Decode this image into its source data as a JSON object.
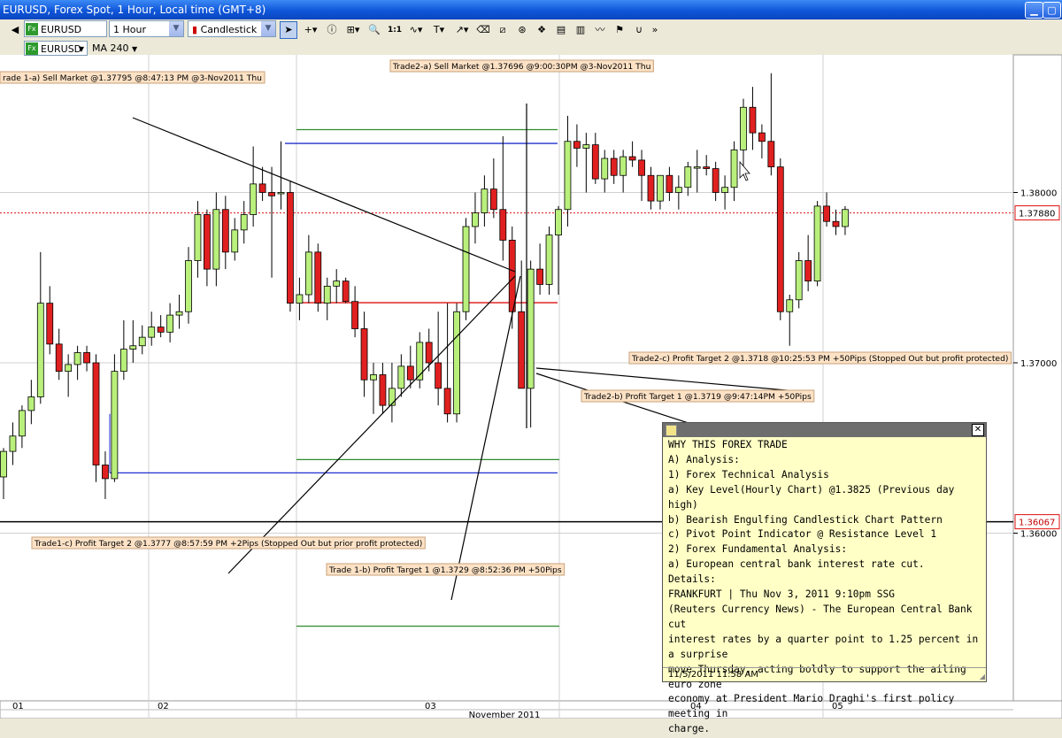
{
  "window": {
    "title": "EURUSD, Forex Spot, 1 Hour, Local time (GMT+8)"
  },
  "toolbar": {
    "symbol": "EURUSD",
    "timeframe": "1 Hour",
    "chart_type": "Candlestick",
    "ratio_label": "1:1",
    "fx_badge": "Fx"
  },
  "indicator_bar": {
    "symbol": "EURUSD",
    "indicator": "MA 240",
    "fx_badge": "Fx"
  },
  "colors": {
    "bull": "#b9f07c",
    "bear": "#e02020",
    "grid": "#d0d0d0",
    "bg": "#ffffff"
  },
  "chart_data": {
    "type": "candlestick",
    "price_axis": {
      "ticks": [
        "1.38000",
        "1.37000",
        "1.36000"
      ],
      "range": [
        1.3537,
        1.389
      ]
    },
    "time_axis": {
      "labels": [
        "01",
        "02",
        "03",
        "04",
        "05"
      ],
      "footer": "November 2011"
    },
    "current_price_label": "1.37880",
    "support_price_label": "1.36067",
    "candles": [
      {
        "o": 1.3633,
        "h": 1.365,
        "l": 1.362,
        "c": 1.3648
      },
      {
        "o": 1.3648,
        "h": 1.3665,
        "l": 1.364,
        "c": 1.3657
      },
      {
        "o": 1.3657,
        "h": 1.3675,
        "l": 1.365,
        "c": 1.3672
      },
      {
        "o": 1.3672,
        "h": 1.369,
        "l": 1.3664,
        "c": 1.368
      },
      {
        "o": 1.368,
        "h": 1.3765,
        "l": 1.3676,
        "c": 1.3735
      },
      {
        "o": 1.3735,
        "h": 1.3745,
        "l": 1.3705,
        "c": 1.3711
      },
      {
        "o": 1.3711,
        "h": 1.372,
        "l": 1.369,
        "c": 1.3695
      },
      {
        "o": 1.3695,
        "h": 1.3705,
        "l": 1.368,
        "c": 1.3699
      },
      {
        "o": 1.3699,
        "h": 1.371,
        "l": 1.369,
        "c": 1.3706
      },
      {
        "o": 1.3706,
        "h": 1.371,
        "l": 1.3695,
        "c": 1.37
      },
      {
        "o": 1.37,
        "h": 1.3705,
        "l": 1.363,
        "c": 1.364
      },
      {
        "o": 1.364,
        "h": 1.3648,
        "l": 1.362,
        "c": 1.3632
      },
      {
        "o": 1.3632,
        "h": 1.3705,
        "l": 1.363,
        "c": 1.3695
      },
      {
        "o": 1.3695,
        "h": 1.3725,
        "l": 1.369,
        "c": 1.3708
      },
      {
        "o": 1.3708,
        "h": 1.3725,
        "l": 1.37,
        "c": 1.371
      },
      {
        "o": 1.371,
        "h": 1.3722,
        "l": 1.3705,
        "c": 1.3715
      },
      {
        "o": 1.3715,
        "h": 1.373,
        "l": 1.371,
        "c": 1.3721
      },
      {
        "o": 1.3721,
        "h": 1.3728,
        "l": 1.3715,
        "c": 1.3718
      },
      {
        "o": 1.3718,
        "h": 1.3735,
        "l": 1.3712,
        "c": 1.3728
      },
      {
        "o": 1.3728,
        "h": 1.374,
        "l": 1.372,
        "c": 1.373
      },
      {
        "o": 1.373,
        "h": 1.3768,
        "l": 1.3723,
        "c": 1.376
      },
      {
        "o": 1.376,
        "h": 1.3795,
        "l": 1.375,
        "c": 1.3787
      },
      {
        "o": 1.3787,
        "h": 1.379,
        "l": 1.3745,
        "c": 1.3755
      },
      {
        "o": 1.3755,
        "h": 1.38,
        "l": 1.3745,
        "c": 1.379
      },
      {
        "o": 1.379,
        "h": 1.3798,
        "l": 1.3755,
        "c": 1.3765
      },
      {
        "o": 1.3765,
        "h": 1.3785,
        "l": 1.376,
        "c": 1.3778
      },
      {
        "o": 1.3778,
        "h": 1.3795,
        "l": 1.377,
        "c": 1.3787
      },
      {
        "o": 1.3787,
        "h": 1.3827,
        "l": 1.378,
        "c": 1.3805
      },
      {
        "o": 1.3805,
        "h": 1.3815,
        "l": 1.3795,
        "c": 1.38
      },
      {
        "o": 1.38,
        "h": 1.3815,
        "l": 1.375,
        "c": 1.3798
      },
      {
        "o": 1.38,
        "h": 1.383,
        "l": 1.379,
        "c": 1.38
      },
      {
        "o": 1.38,
        "h": 1.3807,
        "l": 1.373,
        "c": 1.3735
      },
      {
        "o": 1.3735,
        "h": 1.375,
        "l": 1.3725,
        "c": 1.374
      },
      {
        "o": 1.374,
        "h": 1.3775,
        "l": 1.3735,
        "c": 1.3765
      },
      {
        "o": 1.3765,
        "h": 1.377,
        "l": 1.373,
        "c": 1.3735
      },
      {
        "o": 1.3735,
        "h": 1.375,
        "l": 1.3725,
        "c": 1.3745
      },
      {
        "o": 1.3745,
        "h": 1.3755,
        "l": 1.3735,
        "c": 1.3748
      },
      {
        "o": 1.3748,
        "h": 1.375,
        "l": 1.3735,
        "c": 1.3736
      },
      {
        "o": 1.3736,
        "h": 1.3745,
        "l": 1.3715,
        "c": 1.372
      },
      {
        "o": 1.372,
        "h": 1.373,
        "l": 1.368,
        "c": 1.369
      },
      {
        "o": 1.369,
        "h": 1.37,
        "l": 1.367,
        "c": 1.3693
      },
      {
        "o": 1.3693,
        "h": 1.37,
        "l": 1.367,
        "c": 1.3675
      },
      {
        "o": 1.3675,
        "h": 1.37,
        "l": 1.3665,
        "c": 1.3685
      },
      {
        "o": 1.3685,
        "h": 1.3705,
        "l": 1.368,
        "c": 1.3698
      },
      {
        "o": 1.3698,
        "h": 1.371,
        "l": 1.3685,
        "c": 1.369
      },
      {
        "o": 1.369,
        "h": 1.3718,
        "l": 1.3685,
        "c": 1.3712
      },
      {
        "o": 1.3712,
        "h": 1.372,
        "l": 1.3695,
        "c": 1.37
      },
      {
        "o": 1.37,
        "h": 1.373,
        "l": 1.3675,
        "c": 1.3685
      },
      {
        "o": 1.3685,
        "h": 1.3735,
        "l": 1.3665,
        "c": 1.367
      },
      {
        "o": 1.367,
        "h": 1.3735,
        "l": 1.3665,
        "c": 1.373
      },
      {
        "o": 1.373,
        "h": 1.3785,
        "l": 1.3725,
        "c": 1.378
      },
      {
        "o": 1.378,
        "h": 1.38,
        "l": 1.377,
        "c": 1.3788
      },
      {
        "o": 1.3788,
        "h": 1.381,
        "l": 1.378,
        "c": 1.3802
      },
      {
        "o": 1.3802,
        "h": 1.382,
        "l": 1.3785,
        "c": 1.379
      },
      {
        "o": 1.379,
        "h": 1.3833,
        "l": 1.376,
        "c": 1.3772
      },
      {
        "o": 1.3772,
        "h": 1.378,
        "l": 1.372,
        "c": 1.373
      },
      {
        "o": 1.373,
        "h": 1.376,
        "l": 1.369,
        "c": 1.3685
      },
      {
        "o": 1.3685,
        "h": 1.376,
        "l": 1.3662,
        "c": 1.3755
      },
      {
        "o": 1.3755,
        "h": 1.377,
        "l": 1.374,
        "c": 1.3746
      },
      {
        "o": 1.3746,
        "h": 1.378,
        "l": 1.374,
        "c": 1.3775
      },
      {
        "o": 1.3775,
        "h": 1.3792,
        "l": 1.374,
        "c": 1.379
      },
      {
        "o": 1.379,
        "h": 1.3845,
        "l": 1.378,
        "c": 1.383
      },
      {
        "o": 1.383,
        "h": 1.384,
        "l": 1.3815,
        "c": 1.3826
      },
      {
        "o": 1.3826,
        "h": 1.3835,
        "l": 1.38,
        "c": 1.3828
      },
      {
        "o": 1.3828,
        "h": 1.3835,
        "l": 1.3805,
        "c": 1.3808
      },
      {
        "o": 1.3808,
        "h": 1.3825,
        "l": 1.38,
        "c": 1.382
      },
      {
        "o": 1.382,
        "h": 1.3825,
        "l": 1.3805,
        "c": 1.381
      },
      {
        "o": 1.381,
        "h": 1.3825,
        "l": 1.38,
        "c": 1.3821
      },
      {
        "o": 1.3821,
        "h": 1.383,
        "l": 1.3815,
        "c": 1.3819
      },
      {
        "o": 1.3819,
        "h": 1.3825,
        "l": 1.3795,
        "c": 1.381
      },
      {
        "o": 1.381,
        "h": 1.3815,
        "l": 1.379,
        "c": 1.3795
      },
      {
        "o": 1.3795,
        "h": 1.381,
        "l": 1.379,
        "c": 1.381
      },
      {
        "o": 1.381,
        "h": 1.3815,
        "l": 1.3795,
        "c": 1.38
      },
      {
        "o": 1.38,
        "h": 1.381,
        "l": 1.379,
        "c": 1.3803
      },
      {
        "o": 1.3803,
        "h": 1.3818,
        "l": 1.3798,
        "c": 1.3815
      },
      {
        "o": 1.3815,
        "h": 1.3825,
        "l": 1.38,
        "c": 1.3815
      },
      {
        "o": 1.3815,
        "h": 1.3822,
        "l": 1.381,
        "c": 1.3814
      },
      {
        "o": 1.3814,
        "h": 1.3818,
        "l": 1.3795,
        "c": 1.38
      },
      {
        "o": 1.38,
        "h": 1.381,
        "l": 1.379,
        "c": 1.3803
      },
      {
        "o": 1.3803,
        "h": 1.383,
        "l": 1.3795,
        "c": 1.3825
      },
      {
        "o": 1.3825,
        "h": 1.3855,
        "l": 1.381,
        "c": 1.385
      },
      {
        "o": 1.385,
        "h": 1.3862,
        "l": 1.3825,
        "c": 1.3835
      },
      {
        "o": 1.3835,
        "h": 1.384,
        "l": 1.382,
        "c": 1.383
      },
      {
        "o": 1.383,
        "h": 1.387,
        "l": 1.381,
        "c": 1.3815
      },
      {
        "o": 1.3815,
        "h": 1.382,
        "l": 1.3725,
        "c": 1.373
      },
      {
        "o": 1.373,
        "h": 1.374,
        "l": 1.371,
        "c": 1.3737
      },
      {
        "o": 1.3737,
        "h": 1.3765,
        "l": 1.3732,
        "c": 1.376
      },
      {
        "o": 1.376,
        "h": 1.3775,
        "l": 1.3742,
        "c": 1.3748
      },
      {
        "o": 1.3748,
        "h": 1.3795,
        "l": 1.3745,
        "c": 1.3792
      },
      {
        "o": 1.3792,
        "h": 1.38,
        "l": 1.378,
        "c": 1.3783
      },
      {
        "o": 1.3783,
        "h": 1.379,
        "l": 1.3775,
        "c": 1.378
      },
      {
        "o": 1.378,
        "h": 1.3792,
        "l": 1.3775,
        "c": 1.379
      }
    ],
    "levels": [
      {
        "name": "resistance-green-top",
        "price": 1.38369,
        "color": "#2e8b2e",
        "from": 335,
        "to": 630
      },
      {
        "name": "resistance-blue",
        "price": 1.38288,
        "color": "#2030d0",
        "from": 322,
        "to": 630
      },
      {
        "name": "entry-red",
        "price": 1.37353,
        "color": "#e01010",
        "from": 335,
        "to": 630
      },
      {
        "name": "pivot-green-low",
        "price": 1.36432,
        "color": "#2e8b2e",
        "from": 335,
        "to": 632
      },
      {
        "name": "support-blue-low",
        "price": 1.36354,
        "color": "#2030d0",
        "from": 124,
        "to": 630
      },
      {
        "name": "support-black",
        "price": 1.36067,
        "color": "#000000",
        "from": 0,
        "to": 1145
      },
      {
        "name": "deep-green",
        "price": 1.35454,
        "color": "#2e8b2e",
        "from": 335,
        "to": 632
      }
    ],
    "annotations": [
      {
        "text": "rade 1-a) Sell Market @1.37795 @8:47:13 PM @3-Nov2011 Thu"
      },
      {
        "text": "Trade2-a) Sell Market @1.37696 @9:00:30PM @3-Nov2011 Thu"
      },
      {
        "text": "Trade2-c) Profit Target 2 @1.3718 @10:25:53 PM +50Pips (Stopped Out but profit protected)"
      },
      {
        "text": "Trade2-b) Profit Target 1 @1.3719 @9:47:14PM +50Pips"
      },
      {
        "text": "Trade1-c) Profit Target 2 @1.3777 @8:57:59 PM +2Pips (Stopped Out but prior profit protected)"
      },
      {
        "text": "Trade 1-b) Profit Target 1 @1.3729 @8:52:36 PM +50Pips"
      }
    ]
  },
  "note": {
    "lines": [
      "WHY THIS FOREX TRADE",
      "A) Analysis:",
      "1) Forex Technical Analysis",
      "a) Key Level(Hourly Chart) @1.3825 (Previous day high)",
      "b) Bearish Engulfing Candlestick Chart Pattern",
      "c) Pivot Point Indicator @ Resistance Level 1",
      "2) Forex Fundamental Analysis:",
      "a) European central bank interest rate cut.",
      "Details:",
      "FRANKFURT | Thu Nov 3, 2011 9:10pm SSG",
      "(Reuters Currency News) - The European Central Bank cut",
      "interest rates by a quarter point to 1.25 percent in a surprise",
      "move Thursday, acting boldly to support the ailing euro zone",
      "economy at President Mario Draghi's first policy meeting in",
      "charge."
    ],
    "footer": "11/5/2011 11:58 AM",
    "close_glyph": "✕"
  }
}
